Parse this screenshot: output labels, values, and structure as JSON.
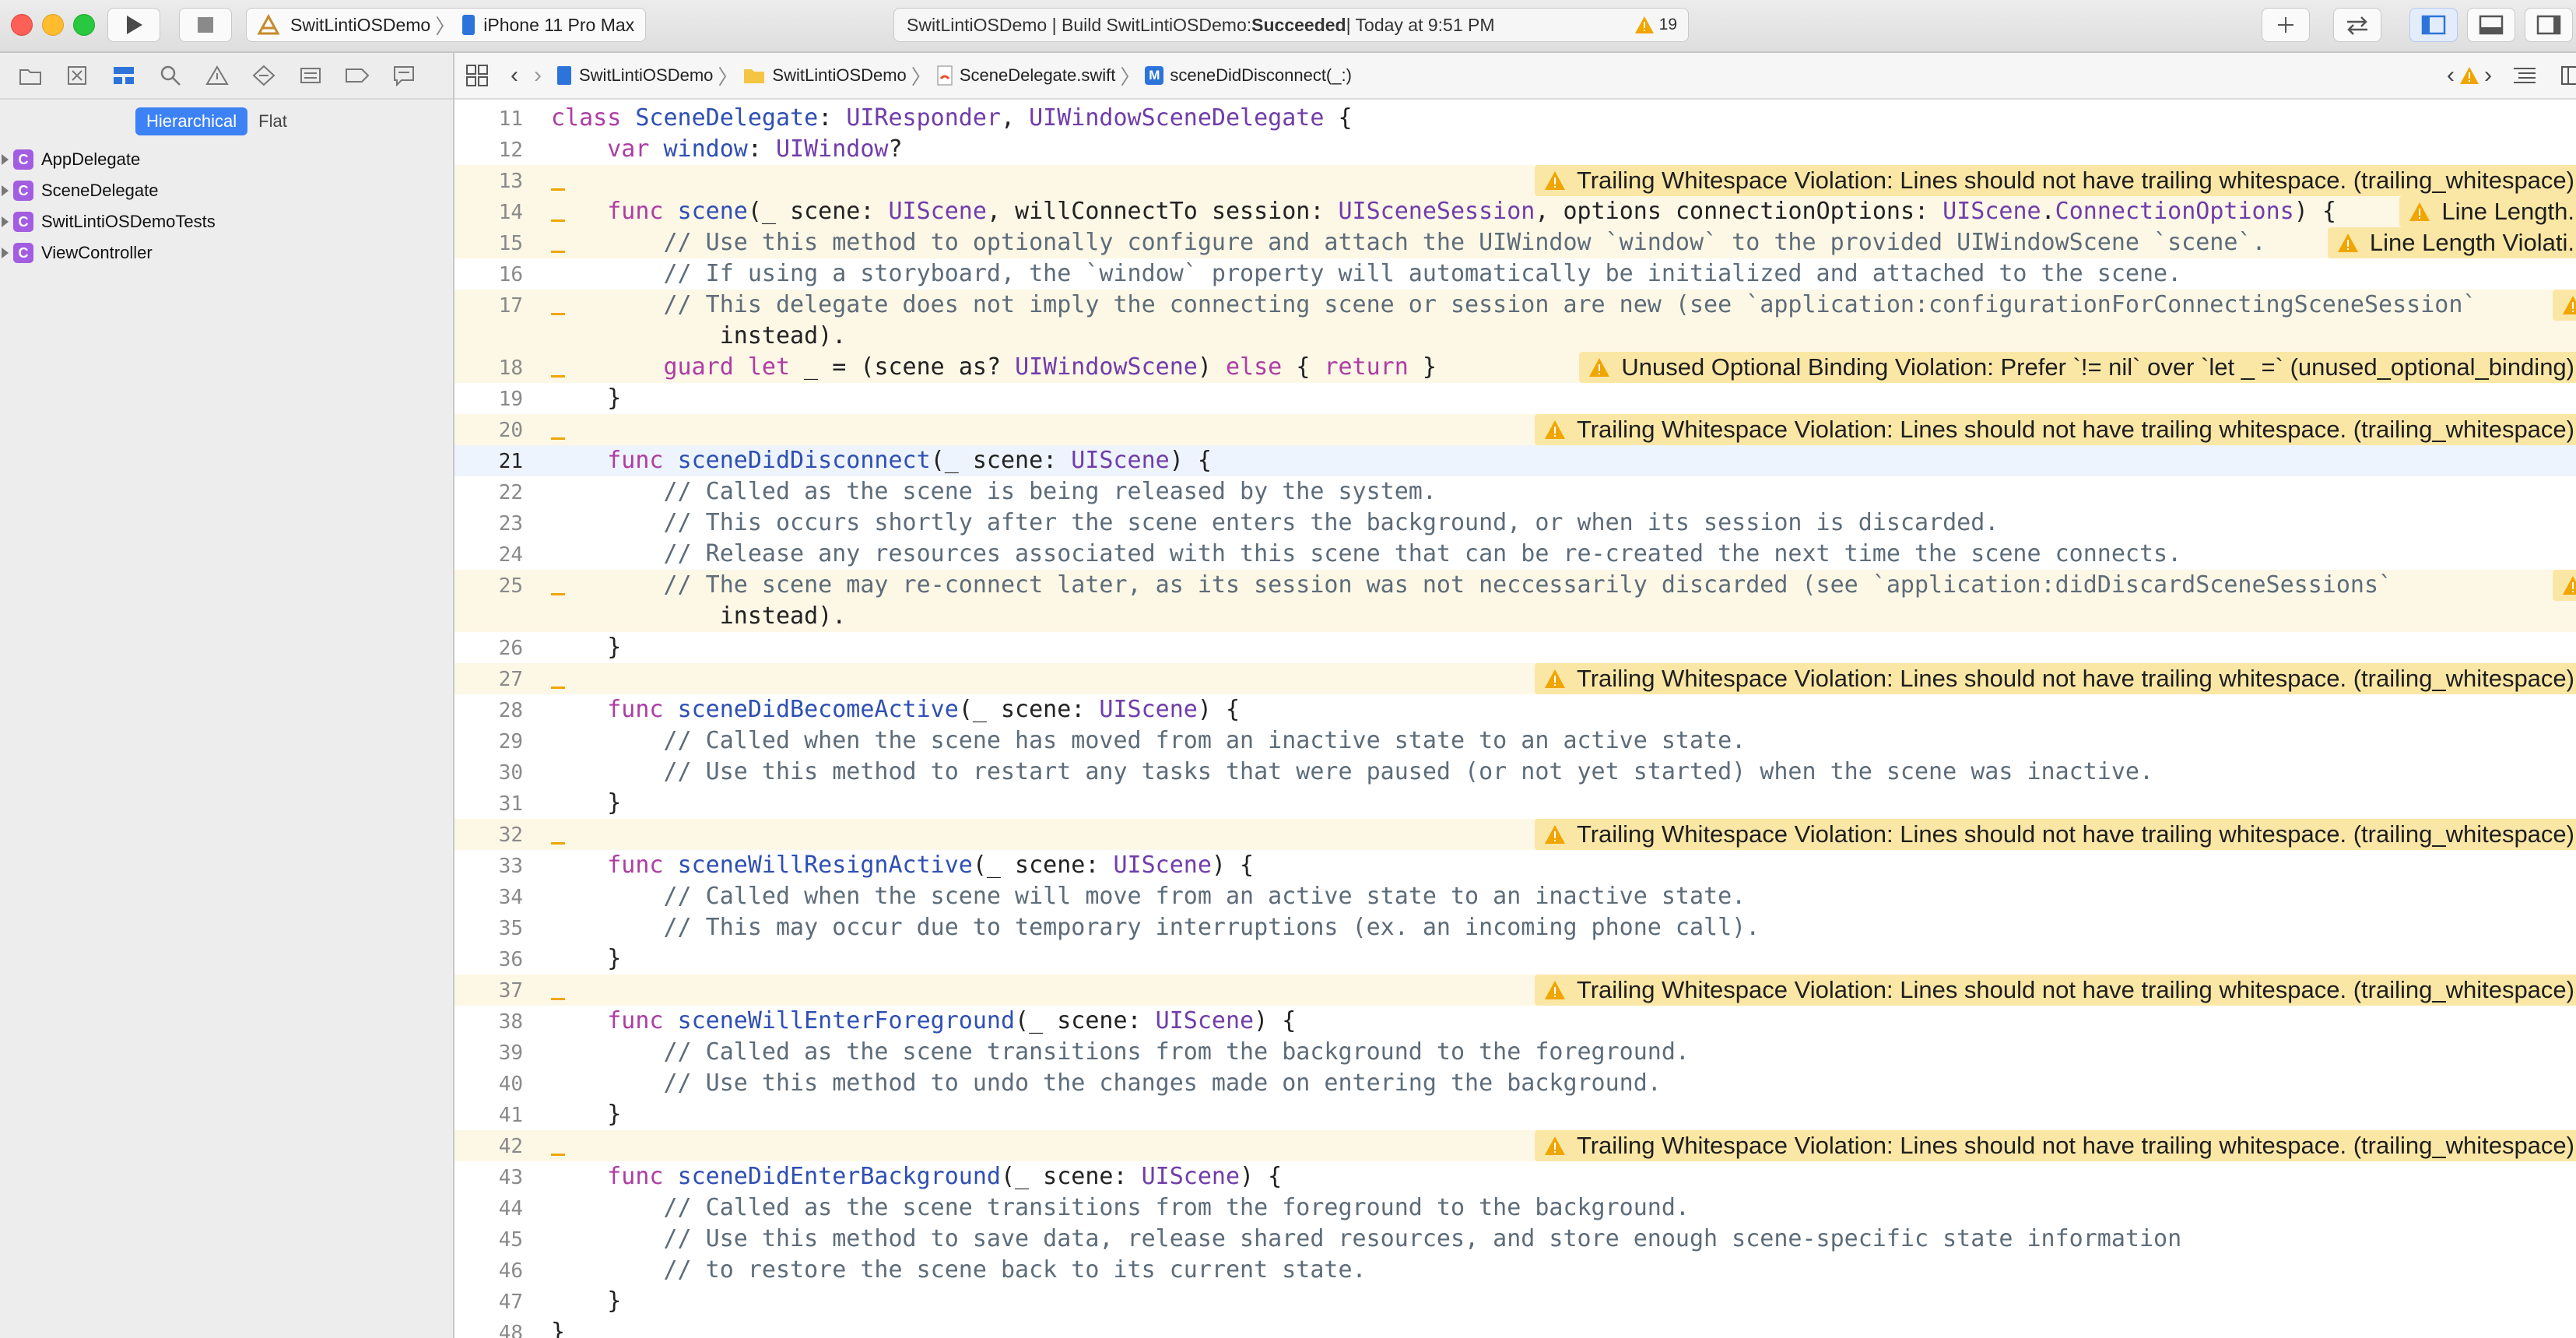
{
  "toolbar": {
    "scheme_target": "SwitLintiOSDemo",
    "scheme_device": "iPhone 11 Pro Max",
    "activity_prefix": "SwitLintiOSDemo | Build SwitLintiOSDemo: ",
    "activity_status": "Succeeded",
    "activity_time": " | Today at 9:51 PM",
    "warning_count": "19",
    "warning_color": "#f0a500"
  },
  "navigator": {
    "segments": [
      "Hierarchical",
      "Flat"
    ],
    "items": [
      {
        "label": "AppDelegate",
        "badge": "C"
      },
      {
        "label": "SceneDelegate",
        "badge": "C"
      },
      {
        "label": "SwitLintiOSDemoTests",
        "badge": "C"
      },
      {
        "label": "ViewController",
        "badge": "C"
      }
    ]
  },
  "jumpbar": {
    "crumbs": [
      "SwitLintiOSDemo",
      "SwitLintiOSDemo",
      "SceneDelegate.swift",
      "sceneDidDisconnect(_:)"
    ],
    "method_badge": "M"
  },
  "editor": {
    "current_line": "21",
    "lines": [
      {
        "n": "11",
        "code": "class SceneDelegate: UIResponder, UIWindowSceneDelegate {"
      },
      {
        "n": "12",
        "code": "    var window: UIWindow?"
      },
      {
        "n": "13",
        "code": "",
        "anno": "Trailing Whitespace Violation: Lines should not have trailing whitespace. (trailing_whitespace)"
      },
      {
        "n": "14",
        "code": "    func scene(_ scene: UIScene, willConnectTo session: UISceneSession, options connectionOptions: UIScene.ConnectionOptions) {",
        "anno": "Line Length."
      },
      {
        "n": "15",
        "code": "        // Use this method to optionally configure and attach the UIWindow `window` to the provided UIWindowScene `scene`.",
        "anno": "Line Length Violati."
      },
      {
        "n": "16",
        "code": "        // If using a storyboard, the `window` property will automatically be initialized and attached to the scene."
      },
      {
        "n": "17",
        "code": "        // This delegate does not imply the connecting scene or session are new (see `application:configurationForConnectingSceneSession`",
        "anno": ""
      },
      {
        "n": "",
        "code": "            instead)."
      },
      {
        "n": "18",
        "code": "        guard let _ = (scene as? UIWindowScene) else { return }",
        "anno": "Unused Optional Binding Violation: Prefer `!= nil` over `let _ =` (unused_optional_binding)"
      },
      {
        "n": "19",
        "code": "    }"
      },
      {
        "n": "20",
        "code": "",
        "anno": "Trailing Whitespace Violation: Lines should not have trailing whitespace. (trailing_whitespace)"
      },
      {
        "n": "21",
        "code": "    func sceneDidDisconnect(_ scene: UIScene) {"
      },
      {
        "n": "22",
        "code": "        // Called as the scene is being released by the system."
      },
      {
        "n": "23",
        "code": "        // This occurs shortly after the scene enters the background, or when its session is discarded."
      },
      {
        "n": "24",
        "code": "        // Release any resources associated with this scene that can be re-created the next time the scene connects."
      },
      {
        "n": "25",
        "code": "        // The scene may re-connect later, as its session was not neccessarily discarded (see `application:didDiscardSceneSessions`",
        "anno": ""
      },
      {
        "n": "",
        "code": "            instead)."
      },
      {
        "n": "26",
        "code": "    }"
      },
      {
        "n": "27",
        "code": "",
        "anno": "Trailing Whitespace Violation: Lines should not have trailing whitespace. (trailing_whitespace)"
      },
      {
        "n": "28",
        "code": "    func sceneDidBecomeActive(_ scene: UIScene) {"
      },
      {
        "n": "29",
        "code": "        // Called when the scene has moved from an inactive state to an active state."
      },
      {
        "n": "30",
        "code": "        // Use this method to restart any tasks that were paused (or not yet started) when the scene was inactive."
      },
      {
        "n": "31",
        "code": "    }"
      },
      {
        "n": "32",
        "code": "",
        "anno": "Trailing Whitespace Violation: Lines should not have trailing whitespace. (trailing_whitespace)"
      },
      {
        "n": "33",
        "code": "    func sceneWillResignActive(_ scene: UIScene) {"
      },
      {
        "n": "34",
        "code": "        // Called when the scene will move from an active state to an inactive state."
      },
      {
        "n": "35",
        "code": "        // This may occur due to temporary interruptions (ex. an incoming phone call)."
      },
      {
        "n": "36",
        "code": "    }"
      },
      {
        "n": "37",
        "code": "",
        "anno": "Trailing Whitespace Violation: Lines should not have trailing whitespace. (trailing_whitespace)"
      },
      {
        "n": "38",
        "code": "    func sceneWillEnterForeground(_ scene: UIScene) {"
      },
      {
        "n": "39",
        "code": "        // Called as the scene transitions from the background to the foreground."
      },
      {
        "n": "40",
        "code": "        // Use this method to undo the changes made on entering the background."
      },
      {
        "n": "41",
        "code": "    }"
      },
      {
        "n": "42",
        "code": "",
        "anno": "Trailing Whitespace Violation: Lines should not have trailing whitespace. (trailing_whitespace)"
      },
      {
        "n": "43",
        "code": "    func sceneDidEnterBackground(_ scene: UIScene) {"
      },
      {
        "n": "44",
        "code": "        // Called as the scene transitions from the foreground to the background."
      },
      {
        "n": "45",
        "code": "        // Use this method to save data, release shared resources, and store enough scene-specific state information"
      },
      {
        "n": "46",
        "code": "        // to restore the scene back to its current state."
      },
      {
        "n": "47",
        "code": "    }"
      },
      {
        "n": "48",
        "code": "}"
      }
    ]
  }
}
